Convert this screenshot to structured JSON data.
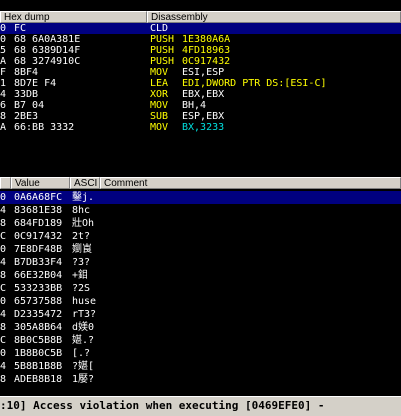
{
  "disasm_pane": {
    "headers": {
      "hex_dump": "Hex dump",
      "disassembly": "Disassembly"
    },
    "rows": [
      {
        "gutter": "0",
        "hex": "FC",
        "mnemonic": "CLD",
        "operand": "",
        "op_color": "white",
        "selected": true
      },
      {
        "gutter": "0",
        "hex": "68 6A0A381E",
        "mnemonic": "PUSH",
        "operand": "1E380A6A",
        "op_color": "yellow"
      },
      {
        "gutter": "5",
        "hex": "68 6389D14F",
        "mnemonic": "PUSH",
        "operand": "4FD18963",
        "op_color": "yellow"
      },
      {
        "gutter": "A",
        "hex": "68 3274910C",
        "mnemonic": "PUSH",
        "operand": "0C917432",
        "op_color": "yellow"
      },
      {
        "gutter": "F",
        "hex": "8BF4",
        "mnemonic": "MOV",
        "operand": "ESI,ESP",
        "op_color": "white"
      },
      {
        "gutter": "1",
        "hex": "8D7E F4",
        "mnemonic": "LEA",
        "operand": "EDI,DWORD PTR DS:[ESI-C]",
        "op_color": "yellow"
      },
      {
        "gutter": "4",
        "hex": "33DB",
        "mnemonic": "XOR",
        "operand": "EBX,EBX",
        "op_color": "white"
      },
      {
        "gutter": "6",
        "hex": "B7 04",
        "mnemonic": "MOV",
        "operand": "BH,4",
        "op_color": "white"
      },
      {
        "gutter": "8",
        "hex": "2BE3",
        "mnemonic": "SUB",
        "operand": "ESP,EBX",
        "op_color": "white"
      },
      {
        "gutter": "A",
        "hex": "66:BB 3332",
        "mnemonic": "MOV",
        "operand": "BX,3233",
        "op_color": "cyan"
      }
    ]
  },
  "stack_pane": {
    "headers": {
      "value": "Value",
      "ascii": "ASCI",
      "comment": "Comment"
    },
    "rows": [
      {
        "gutter": "0",
        "value": "0A6A68FC",
        "ascii": "鑿j.",
        "selected": true
      },
      {
        "gutter": "4",
        "value": "83681E38",
        "ascii": "8hc"
      },
      {
        "gutter": "8",
        "value": "684FD189",
        "ascii": "壯Oh"
      },
      {
        "gutter": "C",
        "value": "0C917432",
        "ascii": "2t?"
      },
      {
        "gutter": "0",
        "value": "7E8DF48B",
        "ascii": "嬼崀"
      },
      {
        "gutter": "4",
        "value": "B7DB33F4",
        "ascii": "?3?"
      },
      {
        "gutter": "8",
        "value": "66E32B04",
        "ascii": "+鉬"
      },
      {
        "gutter": "C",
        "value": "533233BB",
        "ascii": "?2S"
      },
      {
        "gutter": "0",
        "value": "65737588",
        "ascii": "huse"
      },
      {
        "gutter": "4",
        "value": "D2335472",
        "ascii": "rT3?"
      },
      {
        "gutter": "8",
        "value": "305A8B64",
        "ascii": "d媄0"
      },
      {
        "gutter": "C",
        "value": "8B0C5B8B",
        "ascii": "媅.?"
      },
      {
        "gutter": "0",
        "value": "1B8B0C5B",
        "ascii": "[.?"
      },
      {
        "gutter": "4",
        "value": "5B8B1B8B",
        "ascii": "?媅["
      },
      {
        "gutter": "8",
        "value": "ADEB8B18",
        "ascii": "1嬮?"
      }
    ]
  },
  "status_bar": {
    "text": ":10] Access violation when executing [0469EFE0] -"
  }
}
